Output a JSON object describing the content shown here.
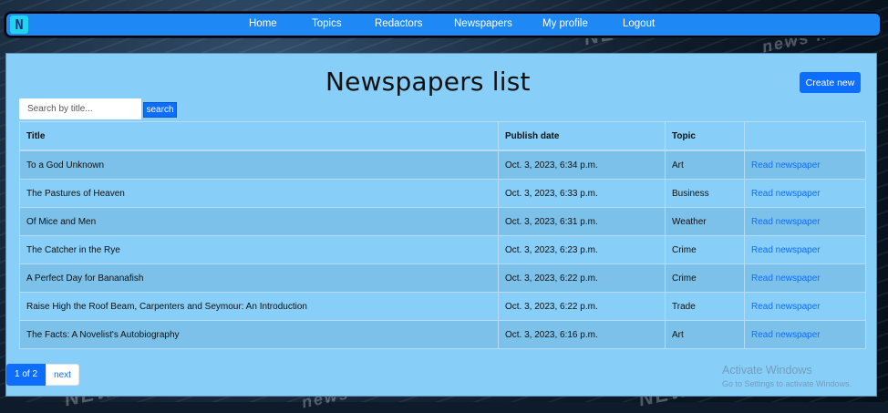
{
  "nav": {
    "brand": "N",
    "links": [
      "Home",
      "Topics",
      "Redactors",
      "Newspapers",
      "My profile",
      "Logout"
    ]
  },
  "page": {
    "title": "Newspapers list",
    "create_label": "Create new"
  },
  "search": {
    "placeholder": "Search by title...",
    "button_label": "search"
  },
  "table": {
    "headers": [
      "Title",
      "Publish date",
      "Topic",
      ""
    ],
    "rows": [
      {
        "title": "To a God Unknown",
        "date": "Oct. 3, 2023, 6:34 p.m.",
        "topic": "Art",
        "link": "Read newspaper"
      },
      {
        "title": "The Pastures of Heaven",
        "date": "Oct. 3, 2023, 6:33 p.m.",
        "topic": "Business",
        "link": "Read newspaper"
      },
      {
        "title": "Of Mice and Men",
        "date": "Oct. 3, 2023, 6:31 p.m.",
        "topic": "Weather",
        "link": "Read newspaper"
      },
      {
        "title": "The Catcher in the Rye",
        "date": "Oct. 3, 2023, 6:23 p.m.",
        "topic": "Crime",
        "link": "Read newspaper"
      },
      {
        "title": "A Perfect Day for Bananafish",
        "date": "Oct. 3, 2023, 6:22 p.m.",
        "topic": "Crime",
        "link": "Read newspaper"
      },
      {
        "title": "Raise High the Roof Beam, Carpenters and Seymour: An Introduction",
        "date": "Oct. 3, 2023, 6:22 p.m.",
        "topic": "Trade",
        "link": "Read newspaper"
      },
      {
        "title": "The Facts: A Novelist's Autobiography",
        "date": "Oct. 3, 2023, 6:16 p.m.",
        "topic": "Art",
        "link": "Read newspaper"
      }
    ]
  },
  "pagination": {
    "current": "1 of 2",
    "next": "next"
  },
  "watermark": {
    "line1": "Activate Windows",
    "line2": "Go to Settings to activate Windows."
  },
  "background_words": [
    "NEWS",
    "news news",
    "NEWS",
    "news news",
    "NEWS"
  ],
  "colors": {
    "navbar": "#1e88f5",
    "panel": "#87cef8",
    "accent": "#0d6efd",
    "brand_icon": "#22d3ee"
  }
}
